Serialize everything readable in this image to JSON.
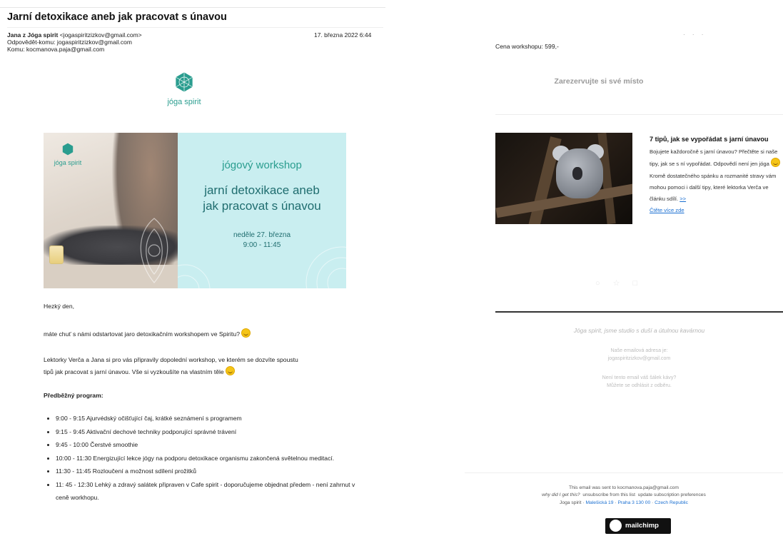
{
  "email": {
    "subject": "Jarní detoxikace aneb jak pracovat s únavou",
    "from_name": "Jana z Jóga spirit",
    "from_addr": "<jogaspiritzizkov@gmail.com>",
    "reply_to": "Odpovědět-komu: jogaspiritzizkov@gmail.com",
    "to": "Komu: kocmanova.paja@gmail.com",
    "date": "17. března 2022 6:44"
  },
  "brand": {
    "logo_text": "jóga spirit",
    "accent": "#2a9d8f"
  },
  "hero": {
    "mini_logo_text": "jóga spirit",
    "kicker": "jógový workshop",
    "title_line1": "jarní detoxikace aneb",
    "title_line2": "jak pracovat s únavou",
    "date_line1": "neděle 27. března",
    "date_line2": "9:00 - 11:45"
  },
  "body": {
    "greeting": "Hezký den,",
    "intro": "máte chuť s námi odstartovat jaro detoxikačním workshopem ve Spiritu?",
    "lecturers_line1": "Lektorky Verča a Jana si pro vás připravily dopolední workshop, ve kterém se dozvíte spoustu",
    "lecturers_line2": "tipů jak pracovat s jarní únavou. Vše si vyzkoušíte na vlastním těle",
    "program_heading": "Předběžný program:",
    "program": [
      "9:00 - 9:15 Ajurvédský očišťující čaj, krátké seznámení s programem",
      "9:15 - 9:45 Aktivační dechové techniky podporující správné trávení",
      "9:45 - 10:00 Čerstvé smoothie",
      "10:00 - 11:30 Energizující lekce jógy na podporu detoxikace organismu zakončená světelnou meditací.",
      "11:30 - 11:45 Rozloučení a možnost sdílení prožitků",
      "11: 45 - 12:30 Lehký a zdravý salátek připraven v Cafe spirit - doporučujeme objednat předem - není zahrnut v ceně workhopu."
    ]
  },
  "right": {
    "price": "Cena workshopu: 599,-",
    "reserve_button": "Zarezervujte si své místo",
    "article": {
      "title": "7 tipů, jak se vypořádat s jarní únavou",
      "text_a": "Bojujete každoročně s jarní únavou? Přečtěte si naše tipy, jak se s ní vypořádat. Odpovědí není jen jóga",
      "text_b": "Kromě dostatečného spánku a rozmanité stravy vám mohou pomoci i další tipy, které lektorka Verča ve článku sdílí.",
      "more_arrow": ">>",
      "more_link": "Čtěte více zde"
    },
    "tagline": "Jóga spirit, jsme studio s duší a útulnou kavárnou",
    "address_label": "Naše emailová adresa je:",
    "address_value": "jogaspiritzizkov@gmail.com",
    "not_cup_line1": "Není tento email váš šálek kávy?",
    "not_cup_line2": "Můžete se odhlásit z odběru."
  },
  "footer": {
    "sent_to": "This email was sent to kocmanova.paja@gmail.com",
    "why": "why did I get this?",
    "unsubscribe": "unsubscribe from this list",
    "update": "update subscription preferences",
    "org": "Joga spirit",
    "street": "Malešická 19",
    "city": "Praha 3 130 00",
    "country": "Czech Republic",
    "mailchimp": "mailchimp"
  }
}
